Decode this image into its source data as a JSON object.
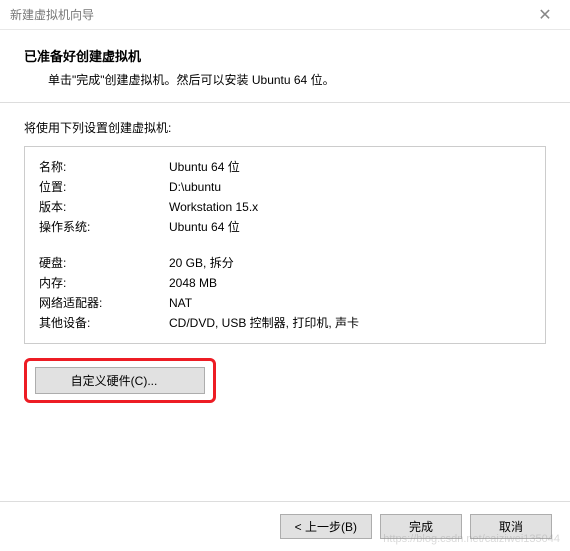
{
  "window": {
    "title": "新建虚拟机向导"
  },
  "header": {
    "title": "已准备好创建虚拟机",
    "subtitle": "单击\"完成\"创建虚拟机。然后可以安装 Ubuntu 64 位。"
  },
  "sectionLabel": "将使用下列设置创建虚拟机:",
  "settings": {
    "rows": [
      {
        "label": "名称:",
        "value": "Ubuntu 64 位"
      },
      {
        "label": "位置:",
        "value": "D:\\ubuntu"
      },
      {
        "label": "版本:",
        "value": "Workstation 15.x"
      },
      {
        "label": "操作系统:",
        "value": "Ubuntu 64 位"
      },
      {
        "label": "硬盘:",
        "value": "20 GB, 拆分"
      },
      {
        "label": "内存:",
        "value": "2048 MB"
      },
      {
        "label": "网络适配器:",
        "value": "NAT"
      },
      {
        "label": "其他设备:",
        "value": "CD/DVD, USB 控制器, 打印机, 声卡"
      }
    ]
  },
  "buttons": {
    "customize": "自定义硬件(C)...",
    "back": "< 上一步(B)",
    "finish": "完成",
    "cancel": "取消"
  },
  "watermark": "https://blog.csdn.net/caiziwei135044"
}
